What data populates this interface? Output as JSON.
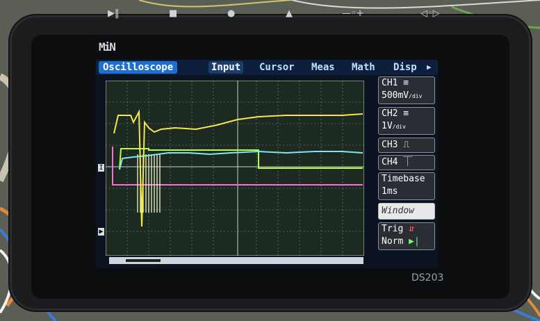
{
  "device": {
    "logo": "MiN",
    "model": "DS203",
    "top_buttons": [
      "▶‖",
      "■",
      "●",
      "▲",
      "—◦+",
      "◁◦▷"
    ]
  },
  "tabs": [
    {
      "label": "Oscilloscope"
    },
    {
      "label": "Input"
    },
    {
      "label": "Cursor"
    },
    {
      "label": "Meas"
    },
    {
      "label": "Math"
    },
    {
      "label": "Disp"
    }
  ],
  "side_panel": {
    "ch1": {
      "name": "CH1 ≡",
      "scale": "500mV",
      "unit": "/div"
    },
    "ch2": {
      "name": "CH2 ≡",
      "scale": "1V",
      "unit": "/div"
    },
    "ch3": {
      "name": "CH3 ⎍"
    },
    "ch4": {
      "name": "CH4 ⏉"
    },
    "timebase": {
      "label": "Timebase",
      "value": "1ms"
    },
    "window": {
      "label": "Window"
    },
    "trig": {
      "label": "Trig",
      "mode": "Norm"
    }
  },
  "colors": {
    "ch1": "#f4e84a",
    "ch2": "#7ee8ee",
    "ch3": "#b8ff3a",
    "ch4": "#ff6fd0",
    "grid": "#9aa8b4",
    "plot_bg": "#16251d"
  }
}
